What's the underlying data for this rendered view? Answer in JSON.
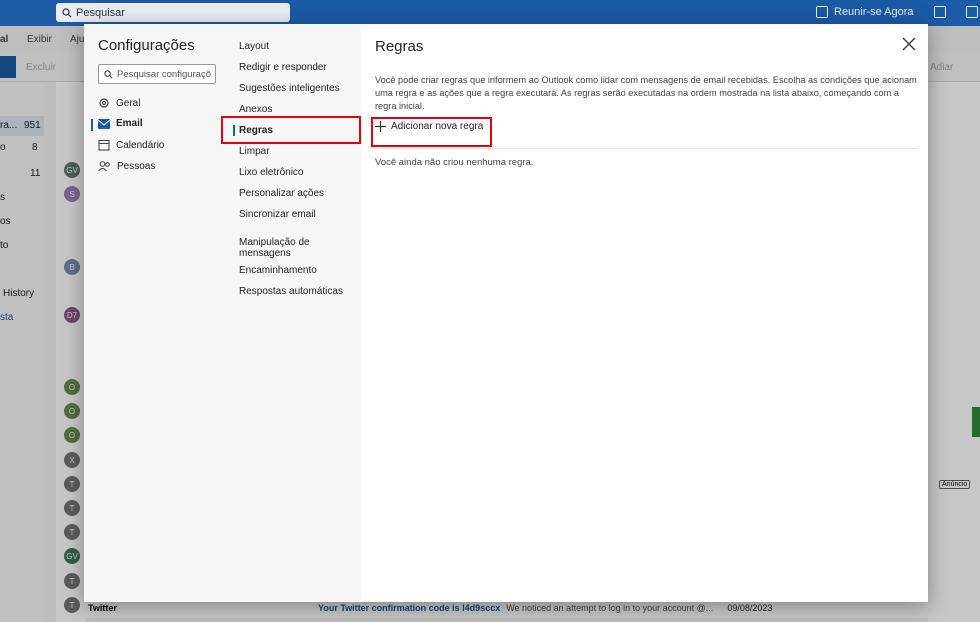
{
  "topbar": {
    "search_placeholder": "Pesquisar",
    "meet_label": "Reunir-se Agora"
  },
  "menubar": {
    "items": [
      "al",
      "Exibir",
      "Aju"
    ]
  },
  "toolbar": {
    "delete_label": "Excluir",
    "snooze_label": "Adiar"
  },
  "leftpane": {
    "rows": [
      {
        "label": "ra...",
        "count": "951"
      },
      {
        "label": "o",
        "count": "8"
      },
      {
        "label": "",
        "count": "11"
      },
      {
        "label": "s",
        "count": ""
      },
      {
        "label": "os",
        "count": ""
      },
      {
        "label": "to",
        "count": ""
      },
      {
        "label": "History",
        "count": ""
      },
      {
        "label": "sta",
        "count": ""
      }
    ]
  },
  "msglist": {
    "avatars": [
      "GV",
      "S",
      "B",
      "D7",
      "O",
      "O",
      "O",
      "X",
      "T",
      "T",
      "T",
      "GV",
      "T",
      "T"
    ]
  },
  "bottom_row": {
    "sender": "Twitter",
    "subject": "Your Twitter confirmation code is l4d9sccx",
    "preview": "We noticed an attempt to log in to your account @...",
    "date": "09/08/2023"
  },
  "rightpane": {
    "ad_label": "Anúncio"
  },
  "dialog": {
    "title": "Configurações",
    "search_placeholder": "Pesquisar configuraçõ",
    "categories": [
      "Geral",
      "Email",
      "Calendário",
      "Pessoas"
    ],
    "subsections": [
      "Layout",
      "Redigir e responder",
      "Sugestões inteligentes",
      "Anexos",
      "Regras",
      "Limpar",
      "Lixo eletrônico",
      "Personalizar ações",
      "Sincronizar email",
      "Manipulação de mensagens",
      "Encaminhamento",
      "Respostas automáticas"
    ],
    "pane": {
      "title": "Regras",
      "description": "Você pode criar regras que informem ao Outlook como lidar com mensagens de email recebidas. Escolha as condições que acionam uma regra e as ações que a regra executará. As regras serão executadas na ordem mostrada na lista abaixo, começando com a regra inicial.",
      "add_rule_label": "Adicionar nova regra",
      "empty_text": "Você ainda não criou nenhuma regra."
    }
  },
  "colors": {
    "accent": "#1b5aa5",
    "highlight": "#e3000f"
  }
}
